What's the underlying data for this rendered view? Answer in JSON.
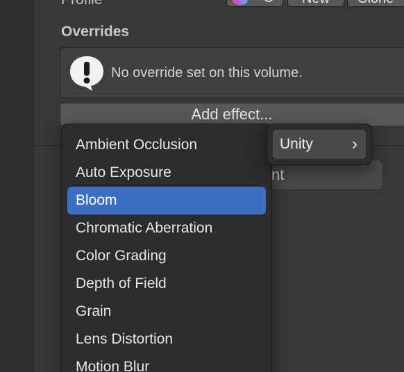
{
  "profile": {
    "label": "Profile",
    "new_label": "New",
    "clone_label": "Clone"
  },
  "overrides": {
    "heading": "Overrides",
    "help_text": "No override set on this volume.",
    "add_effect_label": "Add effect...",
    "underlying_button_label": "nt"
  },
  "menu": {
    "items": [
      {
        "label": "Ambient Occlusion"
      },
      {
        "label": "Auto Exposure"
      },
      {
        "label": "Bloom"
      },
      {
        "label": "Chromatic Aberration"
      },
      {
        "label": "Color Grading"
      },
      {
        "label": "Depth of Field"
      },
      {
        "label": "Grain"
      },
      {
        "label": "Lens Distortion"
      },
      {
        "label": "Motion Blur"
      }
    ],
    "selected_index": 2
  },
  "submenu": {
    "label": "Unity",
    "chevron": "›"
  },
  "colors": {
    "selection": "#3a6fc4",
    "menu_bg": "#2c2c2e",
    "panel_bg": "#383838"
  },
  "icons": {
    "help": "warning-speech-bubble-icon",
    "submenu": "chevron-right-icon"
  }
}
